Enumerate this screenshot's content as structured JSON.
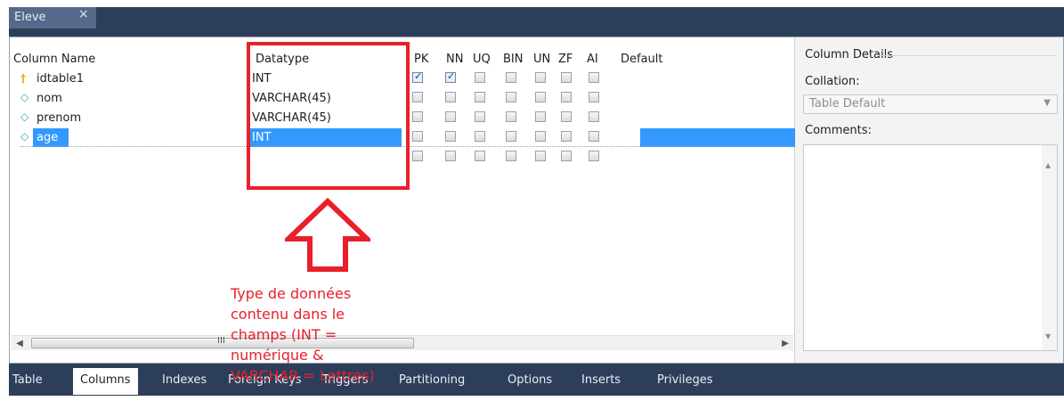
{
  "document_tab": {
    "title": "Eleve",
    "close_glyph": "×"
  },
  "grid": {
    "headers": [
      "Column Name",
      "Datatype",
      "PK",
      "NN",
      "UQ",
      "BIN",
      "UN",
      "ZF",
      "AI",
      "Default"
    ],
    "rows": [
      {
        "icon": "primary-key-icon",
        "name": "idtable1",
        "datatype": "INT",
        "flags": [
          true,
          true,
          false,
          false,
          false,
          false,
          false
        ],
        "default": ""
      },
      {
        "icon": "column-diamond-icon",
        "name": "nom",
        "datatype": "VARCHAR(45)",
        "flags": [
          false,
          false,
          false,
          false,
          false,
          false,
          false
        ],
        "default": ""
      },
      {
        "icon": "column-diamond-icon",
        "name": "prenom",
        "datatype": "VARCHAR(45)",
        "flags": [
          false,
          false,
          false,
          false,
          false,
          false,
          false
        ],
        "default": ""
      },
      {
        "icon": "column-diamond-icon",
        "name": "age",
        "datatype": "INT",
        "flags": [
          false,
          false,
          false,
          false,
          false,
          false,
          false
        ],
        "default": "",
        "selected": true
      },
      {
        "icon": "",
        "name": "",
        "datatype": "",
        "flags": [
          false,
          false,
          false,
          false,
          false,
          false,
          false
        ],
        "default": ""
      }
    ]
  },
  "details": {
    "title": "Column Details",
    "collation_label": "Collation:",
    "collation_value": "Table Default",
    "comments_label": "Comments:"
  },
  "annotation": {
    "text": "Type de données contenu dans le champs (INT = numérique & VARCHAR = Lettres)",
    "color": "#e8202a"
  },
  "bottom_tabs": [
    "Table",
    "Columns",
    "Indexes",
    "Foreign Keys",
    "Triggers",
    "Partitioning",
    "Options",
    "Inserts",
    "Privileges"
  ],
  "active_tab": "Columns",
  "colors": {
    "titlebar": "#2c3e5a",
    "selection": "#3399ff",
    "annotation": "#e8202a"
  }
}
